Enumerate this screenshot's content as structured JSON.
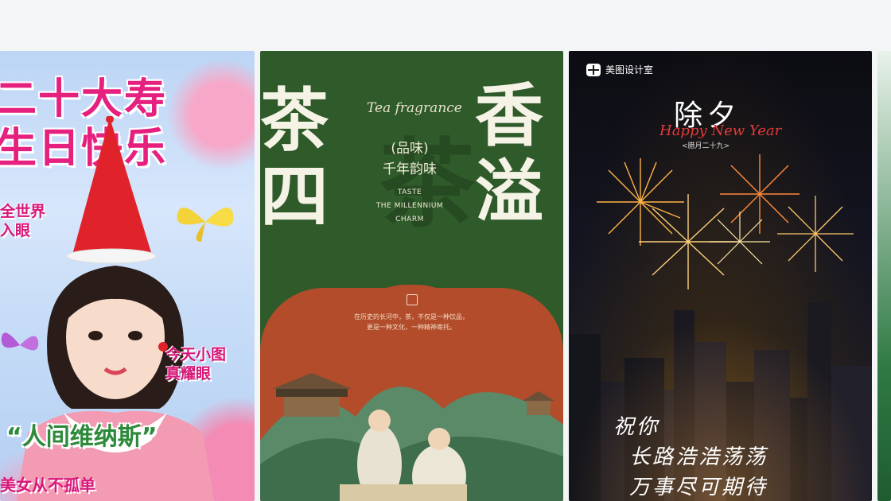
{
  "cards": [
    {
      "name": "birthday",
      "title_line1": "二十大寿",
      "title_line2": "生日快乐",
      "side_left": [
        "全世界",
        "入眼"
      ],
      "side_right": [
        "今天小图",
        "真耀眼"
      ],
      "quote": "“人间维纳斯”",
      "bottom": "美女从不孤单"
    },
    {
      "name": "tea",
      "big_left": [
        "茶",
        "四"
      ],
      "big_right": [
        "香",
        "溢"
      ],
      "english_title": "Tea fragrance",
      "ghost_char": "茶",
      "subtitle": "(品味)",
      "subtitle2": "千年韵味",
      "taste_lines": [
        "TASTE",
        "THE MILLENNIUM",
        "CHARM"
      ],
      "arch_text": [
        "在历史的长河中，茶，不仅是一种饮品，",
        "更是一种文化，一种精神寄托。"
      ]
    },
    {
      "name": "newyear",
      "brand": "美图设计室",
      "title": "除夕",
      "script": "Happy New Year",
      "date": "<腊月二十九>",
      "hand_line1": "祝你",
      "hand_line2": "长路浩浩荡荡",
      "hand_line3": "万事尽可期待"
    }
  ]
}
